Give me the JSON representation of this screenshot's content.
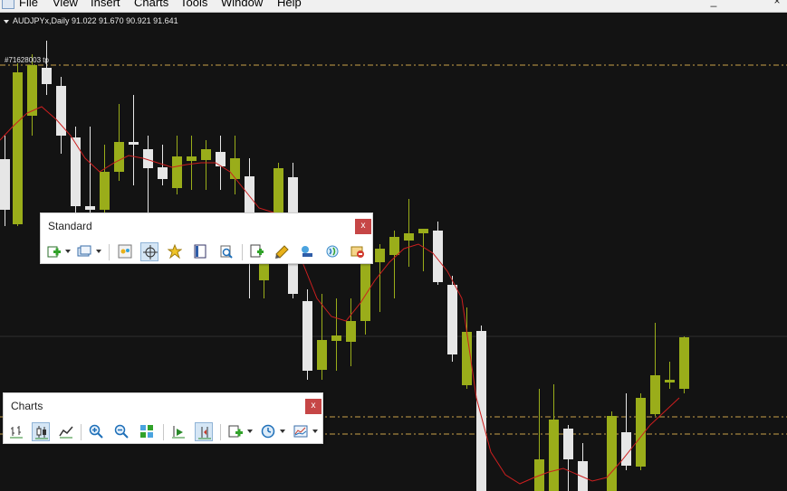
{
  "menu": {
    "items": [
      "File",
      "View",
      "Insert",
      "Charts",
      "Tools",
      "Window",
      "Help"
    ],
    "minimize_glyph": "_",
    "close_glyph": "×"
  },
  "chart": {
    "title": "AUDJPYx,Daily  91.022 91.670 90.921 91.641",
    "order_label": "#71628003 tp",
    "colors": {
      "background": "#131313",
      "bull": "#9aad1a",
      "bear": "#e6e6e6",
      "ma": "#cc1f1f",
      "level": "#c8a04a",
      "grid": "#2f2f2f"
    }
  },
  "toolbars": {
    "standard": {
      "title": "Standard",
      "close": "x",
      "buttons": [
        {
          "name": "new-chart-button",
          "icon": "new-chart-icon",
          "dropdown": true
        },
        {
          "name": "profiles-button",
          "icon": "profiles-icon",
          "dropdown": true
        },
        {
          "name": "market-watch-button",
          "icon": "market-watch-icon",
          "dropdown": false
        },
        {
          "name": "crosshair-button",
          "icon": "crosshair-icon",
          "dropdown": false,
          "active": true
        },
        {
          "name": "navigator-button",
          "icon": "navigator-icon",
          "dropdown": false
        },
        {
          "name": "terminal-button",
          "icon": "terminal-icon",
          "dropdown": false
        },
        {
          "name": "strategy-tester-button",
          "icon": "strategy-tester-icon",
          "dropdown": false
        },
        {
          "name": "new-order-button",
          "icon": "new-order-icon",
          "dropdown": false
        },
        {
          "name": "metaeditor-button",
          "icon": "metaeditor-icon",
          "dropdown": false
        },
        {
          "name": "community-button",
          "icon": "community-icon",
          "dropdown": false
        },
        {
          "name": "signals-button",
          "icon": "signals-icon",
          "dropdown": false
        },
        {
          "name": "auto-trading-button",
          "icon": "auto-trading-icon",
          "dropdown": false
        }
      ]
    },
    "charts": {
      "title": "Charts",
      "close": "x",
      "buttons": [
        {
          "name": "bar-chart-button",
          "icon": "bar-chart-icon"
        },
        {
          "name": "candlesticks-button",
          "icon": "candlesticks-icon",
          "active": true
        },
        {
          "name": "line-chart-button",
          "icon": "line-chart-icon"
        },
        {
          "name": "zoom-in-button",
          "icon": "zoom-in-icon"
        },
        {
          "name": "zoom-out-button",
          "icon": "zoom-out-icon"
        },
        {
          "name": "tile-windows-button",
          "icon": "tile-windows-icon"
        },
        {
          "name": "auto-scroll-button",
          "icon": "auto-scroll-icon"
        },
        {
          "name": "chart-shift-button",
          "icon": "chart-shift-icon",
          "active": true
        },
        {
          "name": "indicators-button",
          "icon": "indicators-icon",
          "dropdown": true
        },
        {
          "name": "periods-button",
          "icon": "periods-icon",
          "dropdown": true
        },
        {
          "name": "templates-button",
          "icon": "templates-icon",
          "dropdown": true
        }
      ]
    }
  }
}
